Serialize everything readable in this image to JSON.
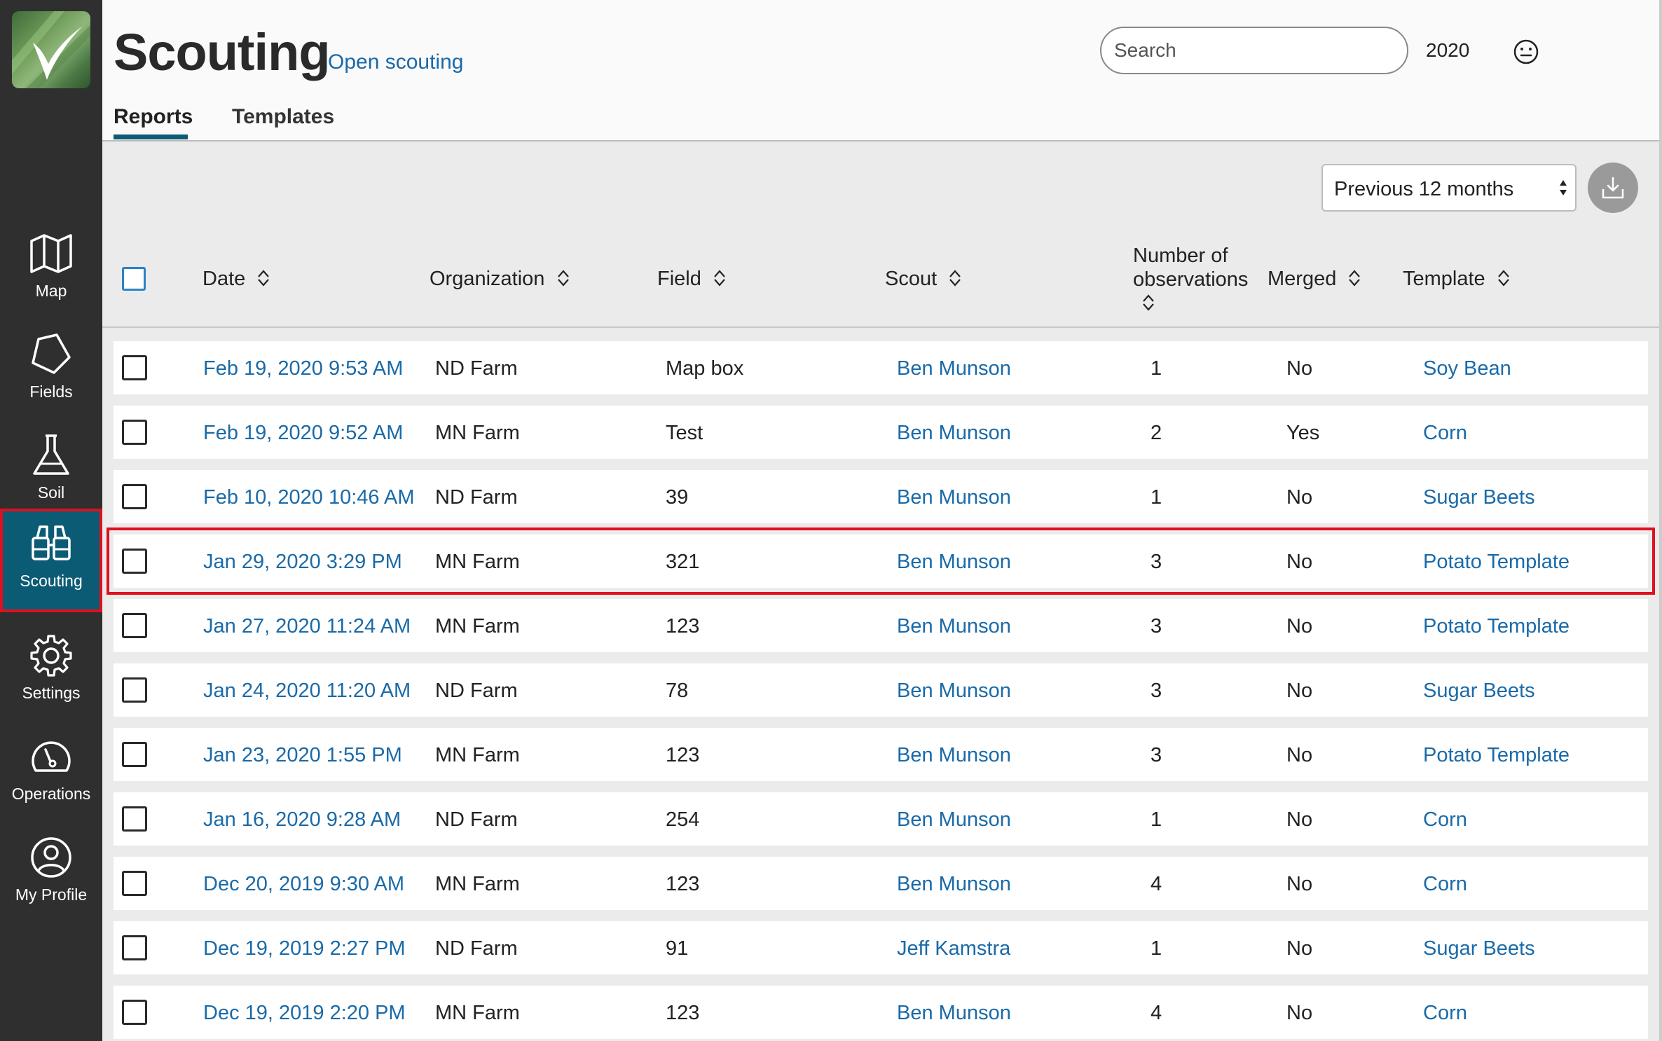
{
  "nav": {
    "items": [
      {
        "label": "Map",
        "icon": "map-icon"
      },
      {
        "label": "Fields",
        "icon": "field-shape-icon"
      },
      {
        "label": "Soil",
        "icon": "flask-icon"
      },
      {
        "label": "Scouting",
        "icon": "binoculars-icon",
        "active": true
      },
      {
        "label": "Settings",
        "icon": "gear-icon"
      },
      {
        "label": "Operations",
        "icon": "gauge-icon"
      },
      {
        "label": "My Profile",
        "icon": "user-icon"
      }
    ]
  },
  "header": {
    "title": "Scouting",
    "open_link": "Open scouting",
    "tabs": [
      {
        "label": "Reports",
        "active": true
      },
      {
        "label": "Templates"
      }
    ],
    "search_placeholder": "Search",
    "year": "2020"
  },
  "toolbar": {
    "period": "Previous 12 months"
  },
  "table": {
    "columns": {
      "date": "Date",
      "organization": "Organization",
      "field": "Field",
      "scout": "Scout",
      "observations_1": "Number of",
      "observations_2": "observations",
      "merged": "Merged",
      "template": "Template"
    },
    "rows": [
      {
        "date": "Feb 19, 2020 9:53 AM",
        "org": "ND Farm",
        "field": "Map box",
        "scout": "Ben Munson",
        "obs": "1",
        "merged": "No",
        "template": "Soy Bean"
      },
      {
        "date": "Feb 19, 2020 9:52 AM",
        "org": "MN Farm",
        "field": "Test",
        "scout": "Ben Munson",
        "obs": "2",
        "merged": "Yes",
        "template": "Corn"
      },
      {
        "date": "Feb 10, 2020 10:46 AM",
        "org": "ND Farm",
        "field": "39",
        "scout": "Ben Munson",
        "obs": "1",
        "merged": "No",
        "template": "Sugar Beets"
      },
      {
        "date": "Jan 29, 2020 3:29 PM",
        "org": "MN Farm",
        "field": "321",
        "scout": "Ben Munson",
        "obs": "3",
        "merged": "No",
        "template": "Potato Template",
        "highlighted": true
      },
      {
        "date": "Jan 27, 2020 11:24 AM",
        "org": "MN Farm",
        "field": "123",
        "scout": "Ben Munson",
        "obs": "3",
        "merged": "No",
        "template": "Potato Template"
      },
      {
        "date": "Jan 24, 2020 11:20 AM",
        "org": "ND Farm",
        "field": "78",
        "scout": "Ben Munson",
        "obs": "3",
        "merged": "No",
        "template": "Sugar Beets"
      },
      {
        "date": "Jan 23, 2020 1:55 PM",
        "org": "MN Farm",
        "field": "123",
        "scout": "Ben Munson",
        "obs": "3",
        "merged": "No",
        "template": "Potato Template"
      },
      {
        "date": "Jan 16, 2020 9:28 AM",
        "org": "ND Farm",
        "field": "254",
        "scout": "Ben Munson",
        "obs": "1",
        "merged": "No",
        "template": "Corn"
      },
      {
        "date": "Dec 20, 2019 9:30 AM",
        "org": "MN Farm",
        "field": "123",
        "scout": "Ben Munson",
        "obs": "4",
        "merged": "No",
        "template": "Corn"
      },
      {
        "date": "Dec 19, 2019 2:27 PM",
        "org": "ND Farm",
        "field": "91",
        "scout": "Jeff Kamstra",
        "obs": "1",
        "merged": "No",
        "template": "Sugar Beets"
      },
      {
        "date": "Dec 19, 2019 2:20 PM",
        "org": "MN Farm",
        "field": "123",
        "scout": "Ben Munson",
        "obs": "4",
        "merged": "No",
        "template": "Corn"
      }
    ]
  },
  "colors": {
    "sidebar": "#2f2f2f",
    "active_nav": "#0c5b74",
    "link": "#1a6aa8",
    "highlight_outline": "#e0101e"
  }
}
